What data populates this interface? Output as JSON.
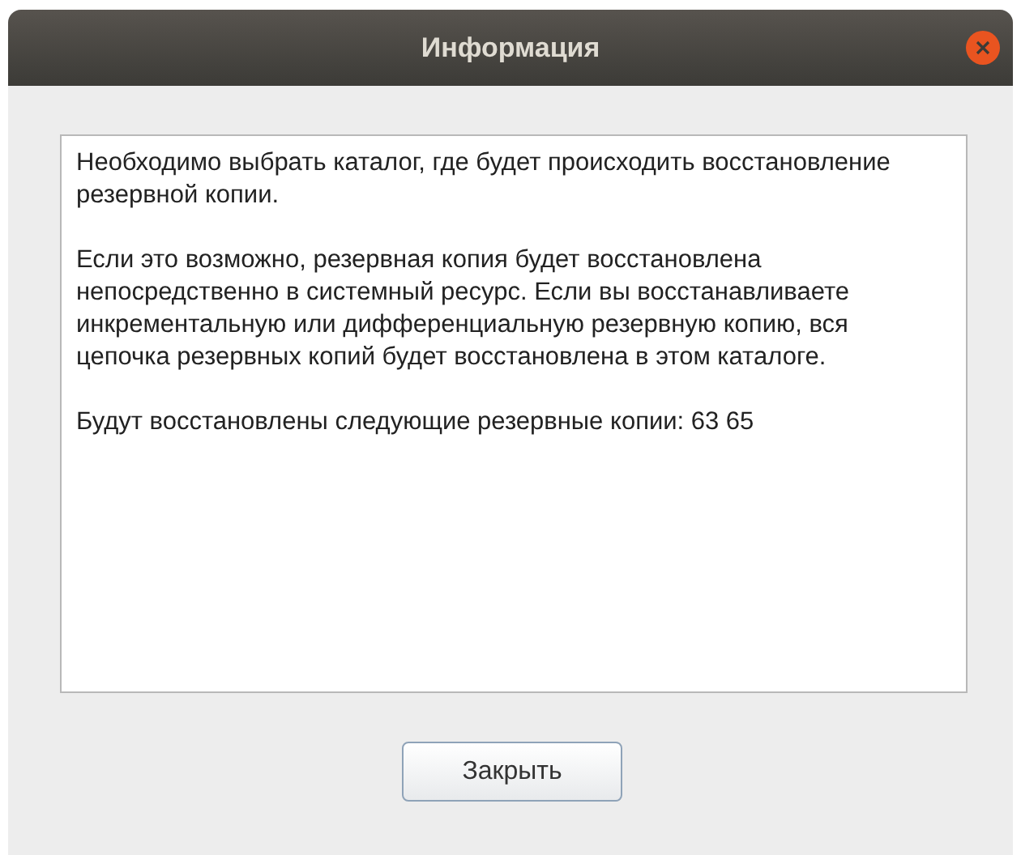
{
  "window": {
    "title": "Информация"
  },
  "message": {
    "paragraphs": [
      "Необходимо выбрать каталог, где будет происходить восстановление резервной копии.",
      "Если это возможно, резервная копия будет восстановлена непосредственно в системный ресурс. Если вы восстанавливаете инкрементальную или дифференциальную резервную копию, вся цепочка резервных копий будет восстановлена в этом каталоге.",
      "Будут восстановлены следующие резервные копии: 63 65"
    ]
  },
  "buttons": [
    "Закрыть"
  ]
}
